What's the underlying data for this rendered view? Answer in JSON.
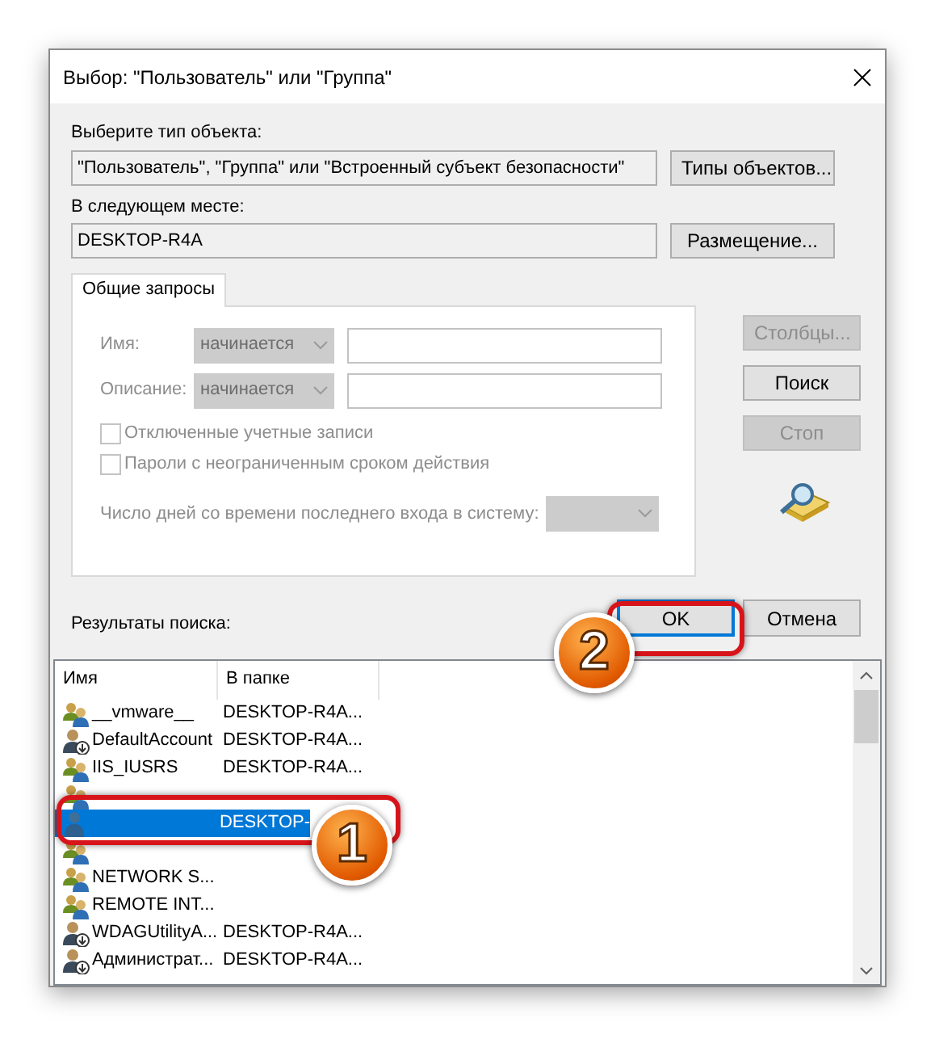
{
  "window": {
    "title": "Выбор: \"Пользователь\" или \"Группа\""
  },
  "object_type": {
    "label": "Выберите тип объекта:",
    "value": "\"Пользователь\", \"Группа\" или \"Встроенный субъект безопасности\"",
    "button": "Типы объектов..."
  },
  "location": {
    "label": "В следующем месте:",
    "value": "DESKTOP-R4A",
    "button": "Размещение..."
  },
  "tabs": [
    {
      "label": "Общие запросы",
      "selected": true
    }
  ],
  "query": {
    "disabled": true,
    "fields": [
      {
        "label": "Имя:",
        "operator": "начинается"
      },
      {
        "label": "Описание:",
        "operator": "начинается"
      }
    ],
    "checkboxes": [
      {
        "label": "Отключенные учетные записи",
        "checked": false
      },
      {
        "label": "Пароли с неограниченным сроком действия",
        "checked": false
      }
    ],
    "days_label": "Число дней со времени последнего входа в систему:"
  },
  "side_buttons": [
    {
      "label": "Столбцы...",
      "disabled": true
    },
    {
      "label": "Поиск",
      "disabled": false
    },
    {
      "label": "Стоп",
      "disabled": true
    }
  ],
  "buttons": [
    {
      "label": "OK",
      "default": true
    },
    {
      "label": "Отмена",
      "default": false
    }
  ],
  "results": {
    "label": "Результаты поиска:",
    "columns": [
      "Имя",
      "В папке"
    ],
    "rows": [
      {
        "kind": "group",
        "name": "__vmware__",
        "folder": "DESKTOP-R4A...",
        "selected": false
      },
      {
        "kind": "user_arrow",
        "name": "DefaultAccount",
        "folder": "DESKTOP-R4A...",
        "selected": false
      },
      {
        "kind": "group",
        "name": "IIS_IUSRS",
        "folder": "DESKTOP-R4A...",
        "selected": false
      },
      {
        "kind": "group",
        "selected": false
      },
      {
        "kind": "user",
        "folder": "DESKTOP-",
        "selected": true
      },
      {
        "kind": "group",
        "selected": false
      },
      {
        "kind": "group",
        "name": "NETWORK S...",
        "selected": false
      },
      {
        "kind": "group",
        "name": "REMOTE INT...",
        "selected": false
      },
      {
        "kind": "user_arrow",
        "name": "WDAGUtilityA...",
        "folder": "DESKTOP-R4A...",
        "selected": false
      },
      {
        "kind": "user_arrow",
        "name": "Администрат...",
        "folder": "DESKTOP-R4A...",
        "selected": false
      }
    ]
  },
  "callouts": [
    {
      "number": "1"
    },
    {
      "number": "2"
    }
  ]
}
